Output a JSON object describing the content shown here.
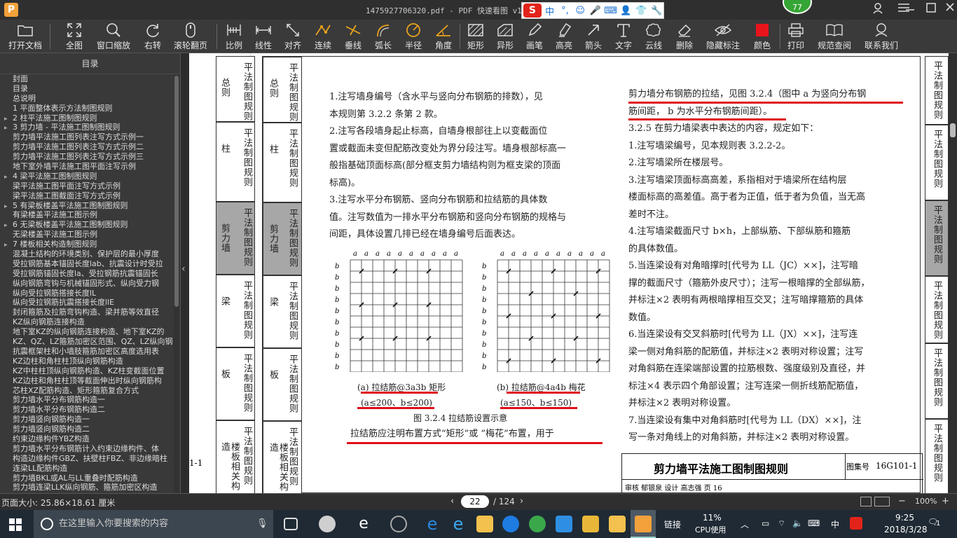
{
  "titlebar": {
    "title": "1475927706320.pdf - PDF 快速看图 v1.9",
    "logo": "P",
    "badge": "77"
  },
  "ime": {
    "logo": "S",
    "items": [
      "中",
      "°,",
      "☺",
      "🎤",
      "⌨",
      "👤",
      "👕",
      "🔧"
    ]
  },
  "toolbar": {
    "buttons": [
      {
        "label": "打开文档",
        "icon": "folder-icon"
      },
      {
        "label": "全图",
        "icon": "expand-icon"
      },
      {
        "label": "窗口缩放",
        "icon": "zoom-icon"
      },
      {
        "label": "右转",
        "icon": "rotate-right-icon"
      },
      {
        "label": "滚轮翻页",
        "icon": "mouse-icon"
      },
      {
        "label": "比例",
        "icon": "scale-icon"
      },
      {
        "label": "线性",
        "icon": "linear-icon"
      },
      {
        "label": "对齐",
        "icon": "align-icon"
      },
      {
        "label": "连续",
        "icon": "continuous-icon"
      },
      {
        "label": "垂线",
        "icon": "perpendicular-icon"
      },
      {
        "label": "弧长",
        "icon": "arc-icon"
      },
      {
        "label": "半径",
        "icon": "radius-icon"
      },
      {
        "label": "角度",
        "icon": "angle-icon"
      },
      {
        "label": "矩形",
        "icon": "rectangle-icon"
      },
      {
        "label": "异形",
        "icon": "polygon-icon"
      },
      {
        "label": "画笔",
        "icon": "pen-icon"
      },
      {
        "label": "高亮",
        "icon": "highlight-icon"
      },
      {
        "label": "箭头",
        "icon": "arrow-icon"
      },
      {
        "label": "文字",
        "icon": "text-icon"
      },
      {
        "label": "云线",
        "icon": "cloud-icon"
      },
      {
        "label": "删除",
        "icon": "eraser-icon"
      },
      {
        "label": "隐藏标注",
        "icon": "hide-icon"
      },
      {
        "label": "颜色",
        "icon": "color-icon"
      },
      {
        "label": "打印",
        "icon": "printer-icon"
      },
      {
        "label": "规范查阅",
        "icon": "book-icon"
      },
      {
        "label": "联系我们",
        "icon": "contact-icon"
      }
    ],
    "color_swatch": "#e8141c"
  },
  "toc": {
    "header": "目录",
    "items": [
      {
        "label": "封面",
        "arrow": ""
      },
      {
        "label": "目录",
        "arrow": ""
      },
      {
        "label": "总说明",
        "arrow": ""
      },
      {
        "label": "1 平面整体表示方法制图规则",
        "arrow": ""
      },
      {
        "label": "2 柱平法施工图制图规则",
        "arrow": "▸"
      },
      {
        "label": "3 剪力墙 - 平法施工图制图规则",
        "arrow": "▸"
      },
      {
        "label": "剪力墙平法施工图列表注写方式示例一",
        "arrow": ""
      },
      {
        "label": "剪力墙平法施工图列表注写方式示例二",
        "arrow": ""
      },
      {
        "label": "剪力墙平法施工图列表注写方式示例三",
        "arrow": ""
      },
      {
        "label": "地下室外墙平法施工图平面注写示例",
        "arrow": ""
      },
      {
        "label": "4 梁平法施工图制图规则",
        "arrow": "▸"
      },
      {
        "label": "梁平法施工图平面注写方式示例",
        "arrow": ""
      },
      {
        "label": "梁平法施工图截面注写方式示例",
        "arrow": ""
      },
      {
        "label": "5 有梁板楼盖平法施工图制图规则",
        "arrow": "▸"
      },
      {
        "label": "有梁楼盖平法施工图示例",
        "arrow": ""
      },
      {
        "label": "6 无梁板楼盖平法施工图制图规则",
        "arrow": "▸"
      },
      {
        "label": "无梁楼盖平法施工图示例",
        "arrow": ""
      },
      {
        "label": "7 楼板相关构造制图规则",
        "arrow": "▸"
      },
      {
        "label": "混凝土结构的环境类别、保护层的最小厚度",
        "arrow": ""
      },
      {
        "label": "受拉钢筋基本锚固长度lab、抗震设计时受拉",
        "arrow": ""
      },
      {
        "label": "受拉钢筋锚固长度la、受拉钢筋抗震锚固长",
        "arrow": ""
      },
      {
        "label": "纵向钢筋弯钩与机械锚固形式、纵向受力钢",
        "arrow": ""
      },
      {
        "label": "纵向受拉钢筋搭接长度lL",
        "arrow": ""
      },
      {
        "label": "纵向受拉钢筋抗震搭接长度llE",
        "arrow": ""
      },
      {
        "label": "封闭箍筋及拉筋弯钩构造、梁并筋等效直径",
        "arrow": ""
      },
      {
        "label": "KZ纵向钢筋连接构造",
        "arrow": ""
      },
      {
        "label": "地下室KZ的纵向钢筋连接构造、地下室KZ的",
        "arrow": ""
      },
      {
        "label": "KZ、QZ、LZ箍筋加密区范围、QZ、LZ纵向钢",
        "arrow": ""
      },
      {
        "label": "抗震框架柱和小墙肢箍筋加密区高度选用表",
        "arrow": ""
      },
      {
        "label": "KZ边柱和角柱柱顶纵向钢筋构造",
        "arrow": ""
      },
      {
        "label": "KZ中柱柱顶纵向钢筋构造、KZ柱变截面位置",
        "arrow": ""
      },
      {
        "label": "KZ边柱和角柱柱顶等截面伸出时纵向钢筋构",
        "arrow": ""
      },
      {
        "label": "芯柱XZ配筋构造、矩形箍筋复合方式",
        "arrow": ""
      },
      {
        "label": "剪力墙水平分布钢筋构造一",
        "arrow": ""
      },
      {
        "label": "剪力墙水平分布钢筋构造二",
        "arrow": ""
      },
      {
        "label": "剪力墙竖向钢筋构造一",
        "arrow": ""
      },
      {
        "label": "剪力墙竖向钢筋构造二",
        "arrow": ""
      },
      {
        "label": "约束边缘构件YBZ构造",
        "arrow": ""
      },
      {
        "label": "剪力墙水平分布钢筋计入约束边缘构件、体",
        "arrow": ""
      },
      {
        "label": "构造边缘构件GBZ、扶壁柱FBZ、非边缘暗柱",
        "arrow": ""
      },
      {
        "label": "连梁LL配筋构造",
        "arrow": ""
      },
      {
        "label": "剪力墙BKL或AL与LL重叠时配筋构造",
        "arrow": ""
      },
      {
        "label": "剪力墙连梁LLK纵向钢筋、箍筋加密区构造",
        "arrow": ""
      }
    ]
  },
  "doc": {
    "left_tabs": [
      {
        "label": "平法制图规则",
        "side": "总则"
      },
      {
        "label": "平法制图规则",
        "side": "柱"
      },
      {
        "label": "平法制图规则",
        "side": "剪力墙"
      },
      {
        "label": "平法制图规则",
        "side": "梁"
      },
      {
        "label": "平法制图规则",
        "side": "板"
      },
      {
        "label": "平法制图规则",
        "side": "楼板相关构造"
      }
    ],
    "inner_tabs": [
      {
        "side": "总则",
        "label": "平法制图规则"
      },
      {
        "side": "柱",
        "label": "平法制图规则"
      },
      {
        "side": "剪力墙",
        "label": "平法制图规则"
      },
      {
        "side": "梁",
        "label": "平法制图规则"
      },
      {
        "side": "板",
        "label": "平法制图规则"
      },
      {
        "side": "楼板相关构造",
        "label": "平法制图规则"
      }
    ],
    "page_frag": "1-1",
    "col1": [
      "1.注写墙身编号（含水平与竖向分布钢筋的排数），见",
      "本规则第 3.2.2 条第 2 款。",
      "2.注写各段墙身起止标高，自墙身根部往上以变截面位",
      "置或截面未变但配筋改变处为界分段注写。墙身根部标高一",
      "般指基础顶面标高(部分框支剪力墙结构则为框支梁的顶面",
      "标高)。",
      "3.注写水平分布钢筋、竖向分布钢筋和拉结筋的具体数",
      "值。注写数值为一排水平分布钢筋和竖向分布钢筋的规格与",
      "间距，具体设置几排已经在墙身编号后面表达。"
    ],
    "fig_a": {
      "caption": "(a) 拉结筋@3a3b 矩形",
      "spacing": "(a≤200、b≤200)"
    },
    "fig_b": {
      "caption": "(b) 拉结筋@4a4b 梅花",
      "spacing": "(a≤150、b≤150)"
    },
    "fig_title": "图 3.2.4 拉结筋设置示意",
    "fig_note": "拉结筋应注明布置方式“矩形”或 “梅花”布置，用于",
    "grid_a_label": "a",
    "grid_b_label": "b",
    "col2": [
      "剪力墙分布钢筋的拉结，见图 3.2.4（图中 a 为竖向分布钢",
      "筋间距，  b 为水平分布钢筋间距）。",
      "3.2.5  在剪力墙梁表中表达的内容，规定如下：",
      "1.注写墙梁编号，见本规则表 3.2.2-2。",
      "2.注写墙梁所在楼层号。",
      "3.注写墙梁顶面标高高差，系指相对于墙梁所在结构层",
      "楼面标高的高差值。高于者为正值，低于者为负值，当无高",
      "差时不注。",
      "4.注写墙梁截面尺寸 b×h，上部纵筋、下部纵筋和箍筋",
      "的具体数值。",
      "5.当连梁设有对角暗撑时[代号为 LL（JC）××]，注写暗",
      "撑的截面尺寸（箍筋外皮尺寸）；注写一根暗撑的全部纵筋，",
      "并标注×2 表明有两根暗撑相互交叉；注写暗撑箍筋的具体",
      "数值。",
      "6.当连梁设有交叉斜筋时[代号为 LL（JX）××]，注写连",
      "梁一侧对角斜筋的配筋值，并标注×2 表明对称设置；注写",
      "对角斜筋在连梁端部设置的拉筋根数、强度级别及直径，并",
      "标注×4 表示四个角部设置；注写连梁一侧折线筋配筋值，",
      "并标注×2 表明对称设置。",
      "7.当连梁设有集中对角斜筋时[代号为 LL（DX）××]，注",
      "写一条对角线上的对角斜筋，并标注×2 表明对称设置。"
    ],
    "titleblock": {
      "title": "剪力墙平法施工图制图规则",
      "label": "图集号",
      "code": "16G101-1",
      "row2": "审核  郁银泉  设计  高志强  页  16"
    },
    "right_tabs": [
      "平法制图规则",
      "平法制图规则",
      "平法制图规则",
      "平法制图规则",
      "平法制图规则",
      "平法制图规则"
    ]
  },
  "status": {
    "page_size": "页面大小: 25.86×18.61 厘米",
    "page_current": "22",
    "page_total": "/ 124",
    "zoom": "100%"
  },
  "taskbar": {
    "search_placeholder": "在这里输入你要搜索的内容",
    "link": "链接",
    "cpu": "11%",
    "cpu_label": "CPU使用",
    "ime": "中",
    "time": "9:25",
    "date": "2018/3/28",
    "notif": "1"
  }
}
